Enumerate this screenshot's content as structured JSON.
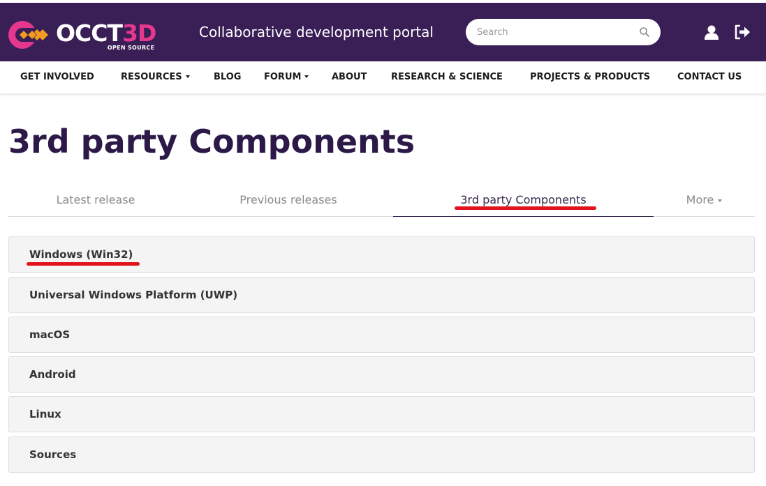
{
  "header": {
    "logo": {
      "word_main": "OCCT",
      "word_accent": "3D",
      "subtitle": "OPEN SOURCE"
    },
    "portal_title": "Collaborative development portal",
    "search": {
      "placeholder": "Search",
      "value": ""
    },
    "colors": {
      "background": "#3a1e56",
      "accent": "#e6378f",
      "accent_orange": "#f39c1f"
    }
  },
  "nav": {
    "items": [
      {
        "label": "GET INVOLVED",
        "dropdown": false
      },
      {
        "label": "RESOURCES",
        "dropdown": true
      },
      {
        "label": "BLOG",
        "dropdown": false
      },
      {
        "label": "FORUM",
        "dropdown": true
      },
      {
        "label": "ABOUT",
        "dropdown": false
      },
      {
        "label": "RESEARCH & SCIENCE",
        "dropdown": false
      },
      {
        "label": "PROJECTS & PRODUCTS",
        "dropdown": false
      },
      {
        "label": "CONTACT US",
        "dropdown": false
      }
    ]
  },
  "page": {
    "title": "3rd party Components"
  },
  "tabs": [
    {
      "label": "Latest release",
      "active": false
    },
    {
      "label": "Previous releases",
      "active": false
    },
    {
      "label": "3rd party Components",
      "active": true
    },
    {
      "label": "More",
      "active": false,
      "dropdown": true
    }
  ],
  "accordion": {
    "panels": [
      {
        "title": "Windows (Win32)"
      },
      {
        "title": "Universal Windows Platform (UWP)"
      },
      {
        "title": "macOS"
      },
      {
        "title": "Android"
      },
      {
        "title": "Linux"
      },
      {
        "title": "Sources"
      }
    ]
  },
  "annotation_color": "#e0141a"
}
